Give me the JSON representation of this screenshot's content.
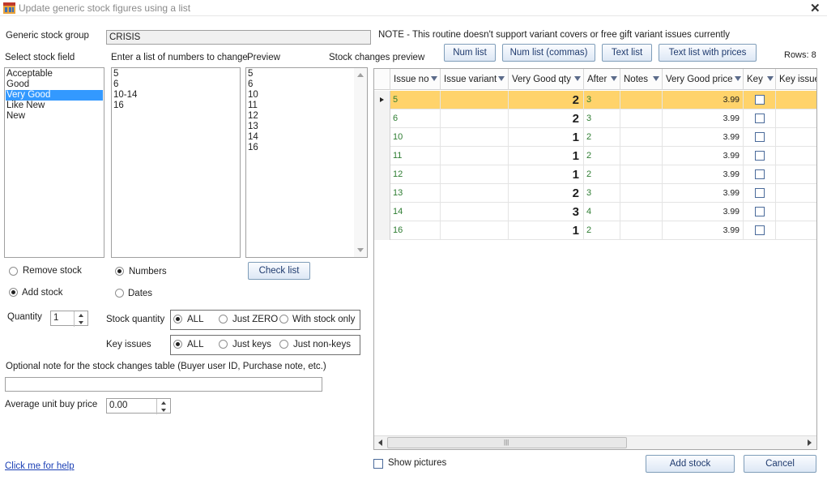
{
  "window": {
    "title": "Update generic stock figures using a list",
    "close_glyph": "✕"
  },
  "generic_group": {
    "label": "Generic stock group",
    "value": "CRISIS"
  },
  "note": "NOTE - This routine doesn't support variant covers or free gift variant issues currently",
  "select_field": {
    "label": "Select stock field",
    "items": [
      "Acceptable",
      "Good",
      "Very Good",
      "Like New",
      "New"
    ],
    "selected": "Very Good"
  },
  "numbers_list": {
    "label": "Enter a list of numbers to change",
    "lines": [
      "5",
      "6",
      "10-14",
      "16"
    ]
  },
  "preview": {
    "label": "Preview",
    "lines": [
      "5",
      "6",
      "10",
      "11",
      "12",
      "13",
      "14",
      "16"
    ]
  },
  "changes_label": "Stock changes preview",
  "toolbar": {
    "num_list": "Num list",
    "num_list_commas": "Num list (commas)",
    "text_list": "Text list",
    "text_list_prices": "Text list with prices",
    "rows": "Rows: 8"
  },
  "mode": {
    "remove": "Remove stock",
    "add": "Add stock",
    "selected": "add"
  },
  "list_type": {
    "numbers": "Numbers",
    "dates": "Dates",
    "selected": "numbers"
  },
  "check_list_button": "Check list",
  "quantity": {
    "label": "Quantity",
    "value": "1"
  },
  "stock_quantity": {
    "label": "Stock quantity",
    "all": "ALL",
    "zero": "Just ZERO",
    "with_stock": "With stock only"
  },
  "key_issues": {
    "label": "Key issues",
    "all": "ALL",
    "keys": "Just keys",
    "non_keys": "Just non-keys"
  },
  "optional_note": {
    "label": "Optional note for the stock changes table (Buyer user ID, Purchase note, etc.)",
    "value": ""
  },
  "avg_price": {
    "label": "Average unit buy price",
    "value": "0.00"
  },
  "help_link": "Click me for help",
  "show_pictures": "Show pictures",
  "add_stock_button": "Add stock",
  "cancel_button": "Cancel",
  "grid": {
    "columns": [
      "Issue no",
      "Issue variant",
      "Very Good qty",
      "After",
      "Notes",
      "Very Good price",
      "Key",
      "Key issue"
    ],
    "rows": [
      {
        "issue": "5",
        "variant": "",
        "qty": "2",
        "after": "3",
        "notes": "",
        "price": "3.99",
        "key": false
      },
      {
        "issue": "6",
        "variant": "",
        "qty": "2",
        "after": "3",
        "notes": "",
        "price": "3.99",
        "key": false
      },
      {
        "issue": "10",
        "variant": "",
        "qty": "1",
        "after": "2",
        "notes": "",
        "price": "3.99",
        "key": false
      },
      {
        "issue": "11",
        "variant": "",
        "qty": "1",
        "after": "2",
        "notes": "",
        "price": "3.99",
        "key": false
      },
      {
        "issue": "12",
        "variant": "",
        "qty": "1",
        "after": "2",
        "notes": "",
        "price": "3.99",
        "key": false
      },
      {
        "issue": "13",
        "variant": "",
        "qty": "2",
        "after": "3",
        "notes": "",
        "price": "3.99",
        "key": false
      },
      {
        "issue": "14",
        "variant": "",
        "qty": "3",
        "after": "4",
        "notes": "",
        "price": "3.99",
        "key": false
      },
      {
        "issue": "16",
        "variant": "",
        "qty": "1",
        "after": "2",
        "notes": "",
        "price": "3.99",
        "key": false
      }
    ]
  }
}
